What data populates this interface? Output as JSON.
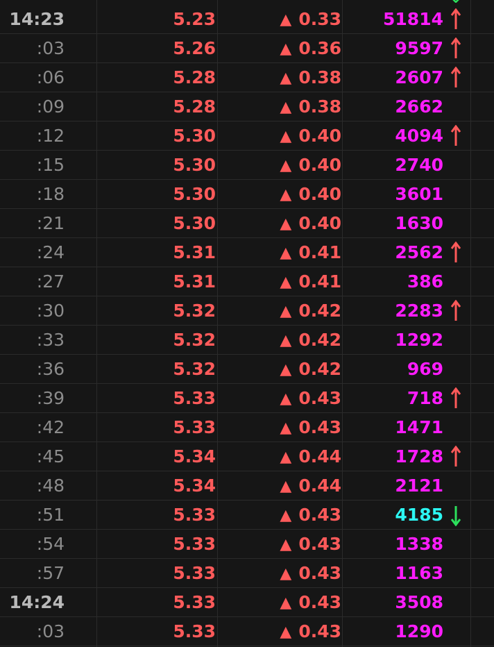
{
  "colors": {
    "background": "#161616",
    "up": "#ff5a5a",
    "volume_up": "#ff1cff",
    "volume_down": "#2cf7f3",
    "arrow_up": "#ff5a5a",
    "arrow_down": "#2ce05c",
    "time": "#8c8c8c"
  },
  "rows": [
    {
      "time": "14:23",
      "hour": true,
      "price": "5.23",
      "change": "0.33",
      "volume": "51814",
      "arrow": "up"
    },
    {
      "time": ":03",
      "hour": false,
      "price": "5.26",
      "change": "0.36",
      "volume": "9597",
      "arrow": "up"
    },
    {
      "time": ":06",
      "hour": false,
      "price": "5.28",
      "change": "0.38",
      "volume": "2607",
      "arrow": "up"
    },
    {
      "time": ":09",
      "hour": false,
      "price": "5.28",
      "change": "0.38",
      "volume": "2662",
      "arrow": "none"
    },
    {
      "time": ":12",
      "hour": false,
      "price": "5.30",
      "change": "0.40",
      "volume": "4094",
      "arrow": "up"
    },
    {
      "time": ":15",
      "hour": false,
      "price": "5.30",
      "change": "0.40",
      "volume": "2740",
      "arrow": "none"
    },
    {
      "time": ":18",
      "hour": false,
      "price": "5.30",
      "change": "0.40",
      "volume": "3601",
      "arrow": "none"
    },
    {
      "time": ":21",
      "hour": false,
      "price": "5.30",
      "change": "0.40",
      "volume": "1630",
      "arrow": "none"
    },
    {
      "time": ":24",
      "hour": false,
      "price": "5.31",
      "change": "0.41",
      "volume": "2562",
      "arrow": "up"
    },
    {
      "time": ":27",
      "hour": false,
      "price": "5.31",
      "change": "0.41",
      "volume": "386",
      "arrow": "none"
    },
    {
      "time": ":30",
      "hour": false,
      "price": "5.32",
      "change": "0.42",
      "volume": "2283",
      "arrow": "up"
    },
    {
      "time": ":33",
      "hour": false,
      "price": "5.32",
      "change": "0.42",
      "volume": "1292",
      "arrow": "none"
    },
    {
      "time": ":36",
      "hour": false,
      "price": "5.32",
      "change": "0.42",
      "volume": "969",
      "arrow": "none"
    },
    {
      "time": ":39",
      "hour": false,
      "price": "5.33",
      "change": "0.43",
      "volume": "718",
      "arrow": "up"
    },
    {
      "time": ":42",
      "hour": false,
      "price": "5.33",
      "change": "0.43",
      "volume": "1471",
      "arrow": "none"
    },
    {
      "time": ":45",
      "hour": false,
      "price": "5.34",
      "change": "0.44",
      "volume": "1728",
      "arrow": "up"
    },
    {
      "time": ":48",
      "hour": false,
      "price": "5.34",
      "change": "0.44",
      "volume": "2121",
      "arrow": "none"
    },
    {
      "time": ":51",
      "hour": false,
      "price": "5.33",
      "change": "0.43",
      "volume": "4185",
      "arrow": "down"
    },
    {
      "time": ":54",
      "hour": false,
      "price": "5.33",
      "change": "0.43",
      "volume": "1338",
      "arrow": "none"
    },
    {
      "time": ":57",
      "hour": false,
      "price": "5.33",
      "change": "0.43",
      "volume": "1163",
      "arrow": "none"
    },
    {
      "time": "14:24",
      "hour": true,
      "price": "5.33",
      "change": "0.43",
      "volume": "3508",
      "arrow": "none"
    },
    {
      "time": ":03",
      "hour": false,
      "price": "5.33",
      "change": "0.43",
      "volume": "1290",
      "arrow": "none"
    }
  ]
}
